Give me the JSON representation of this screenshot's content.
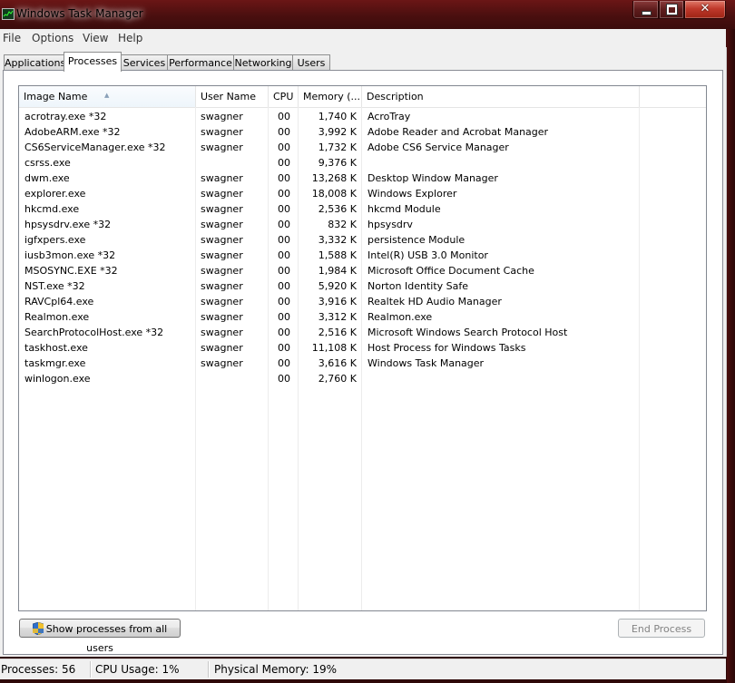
{
  "window": {
    "title": "Windows Task Manager",
    "close_glyph": "✕"
  },
  "menu": [
    "File",
    "Options",
    "View",
    "Help"
  ],
  "tabs": [
    {
      "label": "Applications",
      "active": false
    },
    {
      "label": "Processes",
      "active": true
    },
    {
      "label": "Services",
      "active": false
    },
    {
      "label": "Performance",
      "active": false
    },
    {
      "label": "Networking",
      "active": false
    },
    {
      "label": "Users",
      "active": false
    }
  ],
  "columns": {
    "image_name": "Image Name",
    "user_name": "User Name",
    "cpu": "CPU",
    "memory": "Memory (...",
    "description": "Description"
  },
  "processes": [
    {
      "name": "acrotray.exe *32",
      "user": "swagner",
      "cpu": "00",
      "memory": "1,740 K",
      "desc": "AcroTray"
    },
    {
      "name": "AdobeARM.exe *32",
      "user": "swagner",
      "cpu": "00",
      "memory": "3,992 K",
      "desc": "Adobe Reader and Acrobat Manager"
    },
    {
      "name": "CS6ServiceManager.exe *32",
      "user": "swagner",
      "cpu": "00",
      "memory": "1,732 K",
      "desc": "Adobe CS6 Service Manager"
    },
    {
      "name": "csrss.exe",
      "user": "",
      "cpu": "00",
      "memory": "9,376 K",
      "desc": ""
    },
    {
      "name": "dwm.exe",
      "user": "swagner",
      "cpu": "00",
      "memory": "13,268 K",
      "desc": "Desktop Window Manager"
    },
    {
      "name": "explorer.exe",
      "user": "swagner",
      "cpu": "00",
      "memory": "18,008 K",
      "desc": "Windows Explorer"
    },
    {
      "name": "hkcmd.exe",
      "user": "swagner",
      "cpu": "00",
      "memory": "2,536 K",
      "desc": "hkcmd Module"
    },
    {
      "name": "hpsysdrv.exe *32",
      "user": "swagner",
      "cpu": "00",
      "memory": "832 K",
      "desc": "hpsysdrv"
    },
    {
      "name": "igfxpers.exe",
      "user": "swagner",
      "cpu": "00",
      "memory": "3,332 K",
      "desc": "persistence Module"
    },
    {
      "name": "iusb3mon.exe *32",
      "user": "swagner",
      "cpu": "00",
      "memory": "1,588 K",
      "desc": "Intel(R) USB 3.0 Monitor"
    },
    {
      "name": "MSOSYNC.EXE *32",
      "user": "swagner",
      "cpu": "00",
      "memory": "1,984 K",
      "desc": "Microsoft Office Document Cache"
    },
    {
      "name": "NST.exe *32",
      "user": "swagner",
      "cpu": "00",
      "memory": "5,920 K",
      "desc": "Norton Identity Safe"
    },
    {
      "name": "RAVCpl64.exe",
      "user": "swagner",
      "cpu": "00",
      "memory": "3,916 K",
      "desc": "Realtek HD Audio Manager"
    },
    {
      "name": "Realmon.exe",
      "user": "swagner",
      "cpu": "00",
      "memory": "3,312 K",
      "desc": "Realmon.exe"
    },
    {
      "name": "SearchProtocolHost.exe *32",
      "user": "swagner",
      "cpu": "00",
      "memory": "2,516 K",
      "desc": "Microsoft Windows Search Protocol Host"
    },
    {
      "name": "taskhost.exe",
      "user": "swagner",
      "cpu": "00",
      "memory": "11,108 K",
      "desc": "Host Process for Windows Tasks"
    },
    {
      "name": "taskmgr.exe",
      "user": "swagner",
      "cpu": "00",
      "memory": "3,616 K",
      "desc": "Windows Task Manager"
    },
    {
      "name": "winlogon.exe",
      "user": "",
      "cpu": "00",
      "memory": "2,760 K",
      "desc": ""
    }
  ],
  "buttons": {
    "show_all": "Show processes from all users",
    "end_process": "End Process"
  },
  "status": {
    "processes": "Processes: 56",
    "cpu": "CPU Usage: 1%",
    "memory": "Physical Memory: 19%"
  },
  "colors": {
    "aero_frame": "#4a0e0e",
    "close_button": "#c0392b",
    "sort_header": "#eef5fb"
  }
}
